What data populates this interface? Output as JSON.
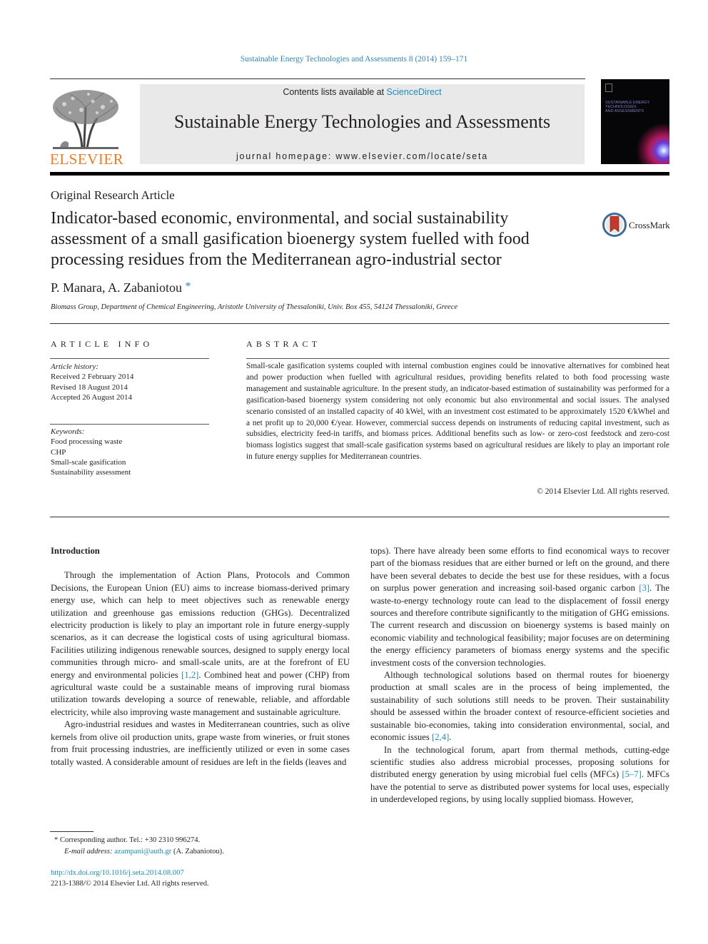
{
  "running_head": "Sustainable Energy Technologies and Assessments 8 (2014) 159–171",
  "masthead": {
    "contents_prefix": "Contents lists available at ",
    "contents_link": "ScienceDirect",
    "journal_title": "Sustainable Energy Technologies and Assessments",
    "homepage": "journal homepage: www.elsevier.com/locate/seta",
    "publisher_logo_text": "ELSEVIER",
    "cover_title_lines": [
      "SUSTAINABLE ENERGY",
      "TECHNOLOGIES",
      "AND ASSESSMENTS"
    ]
  },
  "article": {
    "type": "Original Research Article",
    "title": "Indicator-based economic, environmental, and social sustainability assessment of a small gasification bioenergy system fuelled with food processing residues from the Mediterranean agro-industrial sector",
    "crossmark_label": "CrossMark",
    "authors": "P. Manara, A. Zabaniotou",
    "corresponding_marker": "*",
    "affiliation": "Biomass Group, Department of Chemical Engineering, Aristotle University of Thessaloniki, Univ. Box 455, 54124 Thessaloniki, Greece"
  },
  "article_info": {
    "heading": "ARTICLE INFO",
    "history_label": "Article history:",
    "history": [
      "Received 2 February 2014",
      "Revised 18 August 2014",
      "Accepted 26 August 2014"
    ],
    "keywords_label": "Keywords:",
    "keywords": [
      "Food processing waste",
      "CHP",
      "Small-scale gasification",
      "Sustainability assessment"
    ]
  },
  "abstract": {
    "heading": "ABSTRACT",
    "text": "Small-scale gasification systems coupled with internal combustion engines could be innovative alternatives for combined heat and power production when fuelled with agricultural residues, providing benefits related to both food processing waste management and sustainable agriculture. In the present study, an indicator-based estimation of sustainability was performed for a gasification-based bioenergy system considering not only economic but also environmental and social issues. The analysed scenario consisted of an installed capacity of 40 kWel, with an investment cost estimated to be approximately 1520 €/kWhel and a net profit up to 20,000 €/year. However, commercial success depends on instruments of reducing capital investment, such as subsidies, electricity feed-in tariffs, and biomass prices. Additional benefits such as low- or zero-cost feedstock and zero-cost biomass logistics suggest that small-scale gasification systems based on agricultural residues are likely to play an important role in future energy supplies for Mediterranean countries.",
    "copyright": "© 2014 Elsevier Ltd. All rights reserved."
  },
  "body": {
    "section_heading": "Introduction",
    "left": {
      "p1_a": "Through the implementation of Action Plans, Protocols and Common Decisions, the European Union (EU) aims to increase biomass-derived primary energy use, which can help to meet objectives such as renewable energy utilization and greenhouse gas emissions reduction (GHGs). Decentralized electricity production is likely to play an important role in future energy-supply scenarios, as it can decrease the logistical costs of using agricultural biomass. Facilities utilizing indigenous renewable sources, designed to supply energy local communities through micro- and small-scale units, are at the forefront of EU energy and environmental policies ",
      "p1_ref": "[1,2]",
      "p1_b": ". Combined heat and power (CHP) from agricultural waste could be a sustainable means of improving rural biomass utilization towards developing a source of renewable, reliable, and affordable electricity, while also improving waste management and sustainable agriculture.",
      "p2": "Agro-industrial residues and wastes in Mediterranean countries, such as olive kernels from olive oil production units, grape waste from wineries, or fruit stones from fruit processing industries, are inefficiently utilized or even in some cases totally wasted. A considerable amount of residues are left in the fields (leaves and"
    },
    "right": {
      "p1_a": "tops). There have already been some efforts to find economical ways to recover part of the biomass residues that are either burned or left on the ground, and there have been several debates to decide the best use for these residues, with a focus on surplus power generation and increasing soil-based organic carbon ",
      "p1_ref": "[3]",
      "p1_b": ". The waste-to-energy technology route can lead to the displacement of fossil energy sources and therefore contribute significantly to the mitigation of GHG emissions. The current research and discussion on bioenergy systems is based mainly on economic viability and technological feasibility; major focuses are on determining the energy efficiency parameters of biomass energy systems and the specific investment costs of the conversion technologies.",
      "p2_a": "Although technological solutions based on thermal routes for bioenergy production at small scales are in the process of being implemented, the sustainability of such solutions still needs to be proven. Their sustainability should be assessed within the broader context of resource-efficient societies and sustainable bio-economies, taking into consideration environmental, social, and economic issues ",
      "p2_ref": "[2,4]",
      "p2_b": ".",
      "p3_a": "In the technological forum, apart from thermal methods, cutting-edge scientific studies also address microbial processes, proposing solutions for distributed energy generation by using microbial fuel cells (MFCs) ",
      "p3_ref": "[5–7]",
      "p3_b": ". MFCs have the potential to serve as distributed power systems for local uses, especially in underdeveloped regions, by using locally supplied biomass. However,"
    }
  },
  "footnotes": {
    "marker": "*",
    "corresponding": "Corresponding author. Tel.: +30 2310 996274.",
    "email_label": "E-mail address: ",
    "email": "azampani@auth.gr",
    "email_suffix": " (A. Zabaniotou).",
    "doi": "http://dx.doi.org/10.1016/j.seta.2014.08.007",
    "issn_copyright": "2213-1388/© 2014 Elsevier Ltd. All rights reserved."
  },
  "colors": {
    "link": "#1a8cbc",
    "elsevier_orange": "#f47920",
    "masthead_bg": "#e9e9e9"
  }
}
